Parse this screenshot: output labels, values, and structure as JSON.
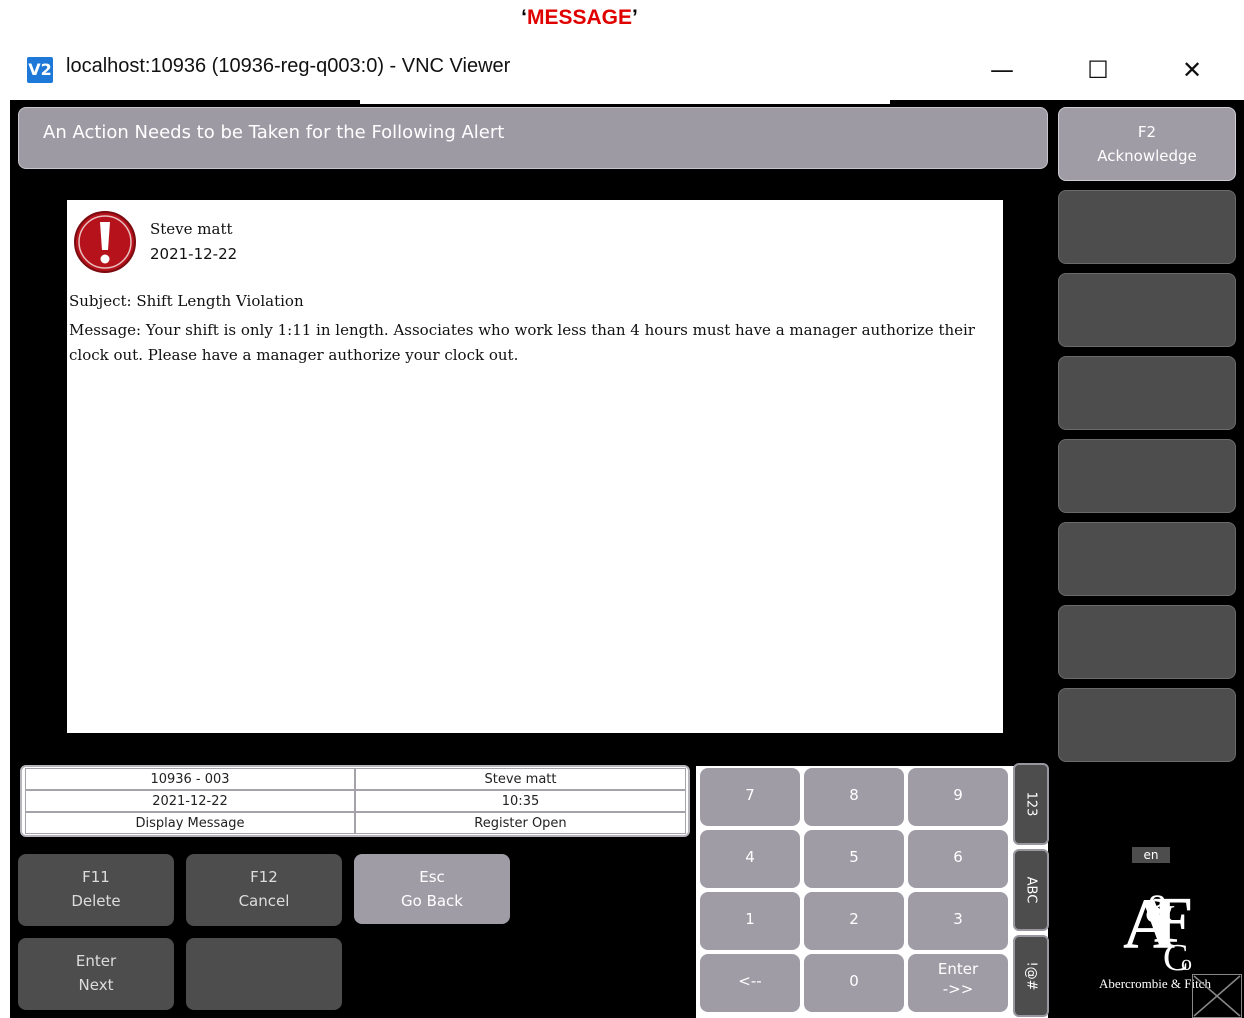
{
  "caption": {
    "quote_open": "‘",
    "text": "MESSAGE",
    "quote_close": "’"
  },
  "window": {
    "logo": "V2",
    "title": "localhost:10936 (10936-reg-q003:0) - VNC Viewer",
    "minimize": "—",
    "maximize": "☐",
    "close": "✕"
  },
  "header": {
    "title": "An Action Needs to be Taken for the Following Alert"
  },
  "side_buttons": {
    "acknowledge_key": "F2",
    "acknowledge_label": "Acknowledge"
  },
  "message": {
    "author": "Steve matt",
    "date": "2021-12-22",
    "subject": "Subject: Shift Length Violation",
    "body": "Message: Your shift is only 1:11 in length. Associates who work less than 4 hours must have a manager authorize their clock out. Please have a manager authorize your clock out."
  },
  "status": {
    "register": "10936 - 003",
    "user": "Steve matt",
    "date": "2021-12-22",
    "time": "10:35",
    "mode": "Display Message",
    "register_state": "Register Open"
  },
  "function_buttons": {
    "f11_key": "F11",
    "f11_label": "Delete",
    "f12_key": "F12",
    "f12_label": "Cancel",
    "esc_key": "Esc",
    "esc_label": "Go Back",
    "enter_key": "Enter",
    "enter_label": "Next"
  },
  "keypad": {
    "k7": "7",
    "k8": "8",
    "k9": "9",
    "k4": "4",
    "k5": "5",
    "k6": "6",
    "k1": "1",
    "k2": "2",
    "k3": "3",
    "back": "<--",
    "k0": "0",
    "enter_top": "Enter",
    "enter_bottom": "->>"
  },
  "mode_tabs": {
    "numeric": "123",
    "alpha": "ABC",
    "symbols": "!@#"
  },
  "branding": {
    "language": "en",
    "logo_text": "Abercrombie & Fitch"
  },
  "colors": {
    "alert_red": "#b5121b",
    "caption_red": "#e00000",
    "button_gray": "#a09ca6",
    "dark_button": "#4d4d4d"
  }
}
